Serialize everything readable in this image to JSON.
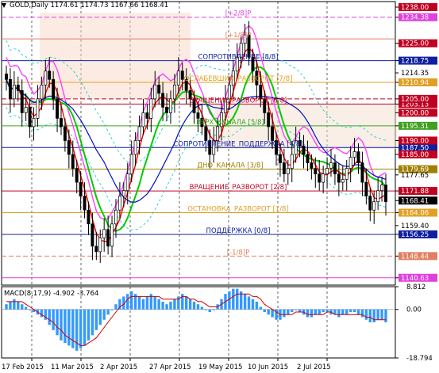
{
  "header": {
    "symbol": "GOLD,Daily",
    "ohlc": "1174.61 1174.73 1167.66 1168.41"
  },
  "macd": {
    "label": "MACD(8,17,9) -4.902 -3.764",
    "scale": [
      "8.812",
      "0.00",
      "-18.794"
    ]
  },
  "price_scale": [
    "1238.00",
    "1234.38",
    "1225.00",
    "1218.75",
    "1214.35",
    "1210.94",
    "1205.00",
    "1203.13",
    "1200.00",
    "1195.31",
    "1190.00",
    "1187.50",
    "1185.00",
    "1179.69",
    "1177.65",
    "1171.88",
    "1168.41",
    "1164.06",
    "1159.40",
    "1156.25",
    "1148.44",
    "1140.63"
  ],
  "highlighted_prices": [
    "1210.94",
    "1203.13",
    "1195.31",
    "1187.50",
    "1179.69",
    "1171.88",
    "1168.41",
    "1164.06",
    "1156.25",
    "1148.44",
    "1140.63"
  ],
  "time_axis": [
    "17 Feb 2015",
    "11 Mar 2015",
    "2 Apr 2015",
    "27 Apr 2015",
    "19 May 2015",
    "10 Jun 2015",
    "2 Jul 2015"
  ],
  "levels": [
    {
      "label": "[+2/8]P",
      "price": 1234.38,
      "color": "#e040e0"
    },
    {
      "label": "[+1/8]P",
      "price": 1226.56,
      "color": "#e08060"
    },
    {
      "label": "СОПРОТИВЛЕНИЕ [8/8]",
      "price": 1218.75,
      "color": "#1020a0"
    },
    {
      "label": "ОСЛАБЕВШИЙ_РАЗВОРОТ [7/8]",
      "price": 1210.94,
      "color": "#e0a020"
    },
    {
      "label": "ВРАЩЕНИЕ_РАЗВОРОТ [6/8]",
      "price": 1203.13,
      "color": "#c00020"
    },
    {
      "label": "ВЕРХ_КАНАЛА [5/8]",
      "price": 1195.31,
      "color": "#40a020"
    },
    {
      "label": "СОПРОТИВЛЕНИЕ_ПОДДЕРЖКА [4/8]",
      "price": 1187.5,
      "color": "#1020a0"
    },
    {
      "label": "ДНО_КАНАЛА [3/8]",
      "price": 1179.69,
      "color": "#a08000"
    },
    {
      "label": "ВРАЩЕНИЕ_РАЗВОРОТ [2/8]",
      "price": 1171.88,
      "color": "#c00020"
    },
    {
      "label": "ОСТАНОВКА_РАЗВОРОТ [1/8]",
      "price": 1164.06,
      "color": "#e0a020"
    },
    {
      "label": "ПОДДЕРЖКА [0/8]",
      "price": 1156.25,
      "color": "#1020a0"
    },
    {
      "label": "[-1/8]P",
      "price": 1148.44,
      "color": "#e08060"
    }
  ],
  "colors": {
    "up_candle": "#000000",
    "down_candle": "#000000",
    "macd_hist": "#3399ff",
    "macd_signal": "#cc0000",
    "bg": "#ffffff"
  },
  "chart_data": {
    "type": "candlestick",
    "symbol": "GOLD",
    "timeframe": "Daily",
    "x": [
      "17 Feb 2015",
      "11 Mar 2015",
      "2 Apr 2015",
      "27 Apr 2015",
      "19 May 2015",
      "10 Jun 2015",
      "2 Jul 2015"
    ],
    "ylim": [
      1138,
      1240
    ],
    "last_close": 1168.41,
    "closes": [
      1212,
      1205,
      1210,
      1208,
      1200,
      1202,
      1195,
      1198,
      1205,
      1210,
      1215,
      1212,
      1205,
      1198,
      1195,
      1190,
      1185,
      1180,
      1175,
      1170,
      1165,
      1160,
      1152,
      1150,
      1155,
      1158,
      1152,
      1160,
      1165,
      1170,
      1172,
      1178,
      1185,
      1190,
      1195,
      1200,
      1198,
      1205,
      1210,
      1207,
      1202,
      1200,
      1205,
      1210,
      1215,
      1212,
      1208,
      1205,
      1200,
      1198,
      1195,
      1190,
      1185,
      1190,
      1195,
      1200,
      1205,
      1210,
      1215,
      1220,
      1225,
      1228,
      1220,
      1215,
      1210,
      1205,
      1200,
      1195,
      1190,
      1185,
      1182,
      1178,
      1180,
      1185,
      1190,
      1188,
      1185,
      1182,
      1180,
      1178,
      1175,
      1178,
      1180,
      1182,
      1178,
      1175,
      1176,
      1180,
      1184,
      1186,
      1182,
      1175,
      1170,
      1165,
      1168,
      1172,
      1174,
      1168
    ],
    "macd_histogram": [
      2,
      3,
      4,
      3,
      2,
      1,
      0,
      -1,
      -2,
      -3,
      -4,
      -6,
      -8,
      -10,
      -12,
      -13,
      -14,
      -15,
      -16,
      -15,
      -14,
      -12,
      -10,
      -8,
      -6,
      -4,
      -2,
      0,
      2,
      4,
      5,
      6,
      7,
      6,
      5,
      4,
      5,
      6,
      5,
      4,
      3,
      2,
      3,
      4,
      5,
      6,
      5,
      4,
      3,
      2,
      1,
      0,
      -1,
      0,
      2,
      4,
      6,
      7,
      8,
      8,
      7,
      6,
      5,
      4,
      3,
      1,
      -1,
      -2,
      -3,
      -4,
      -4,
      -3,
      -2,
      -1,
      0,
      -1,
      -2,
      -3,
      -3,
      -2,
      -2,
      -1,
      -1,
      -2,
      -2,
      -3,
      -2,
      -2,
      -1,
      -1,
      -2,
      -3,
      -4,
      -5,
      -5,
      -4,
      -4,
      -5
    ],
    "macd_signal": [
      3,
      3,
      3,
      3,
      3,
      2,
      1,
      0,
      -1,
      -2,
      -3,
      -4,
      -5,
      -7,
      -8,
      -10,
      -11,
      -12,
      -13,
      -14,
      -14,
      -13,
      -12,
      -11,
      -9,
      -7,
      -5,
      -3,
      -1,
      1,
      2,
      4,
      5,
      5,
      5,
      5,
      5,
      5,
      5,
      5,
      4,
      4,
      4,
      4,
      4,
      5,
      5,
      4,
      4,
      3,
      3,
      2,
      1,
      1,
      1,
      2,
      3,
      4,
      5,
      6,
      6,
      6,
      6,
      5,
      5,
      4,
      2,
      1,
      0,
      -1,
      -2,
      -2,
      -2,
      -2,
      -1,
      -1,
      -1,
      -2,
      -2,
      -2,
      -2,
      -2,
      -1,
      -1,
      -2,
      -2,
      -2,
      -2,
      -2,
      -2,
      -2,
      -2,
      -3,
      -3,
      -4,
      -4,
      -4,
      -4
    ]
  }
}
